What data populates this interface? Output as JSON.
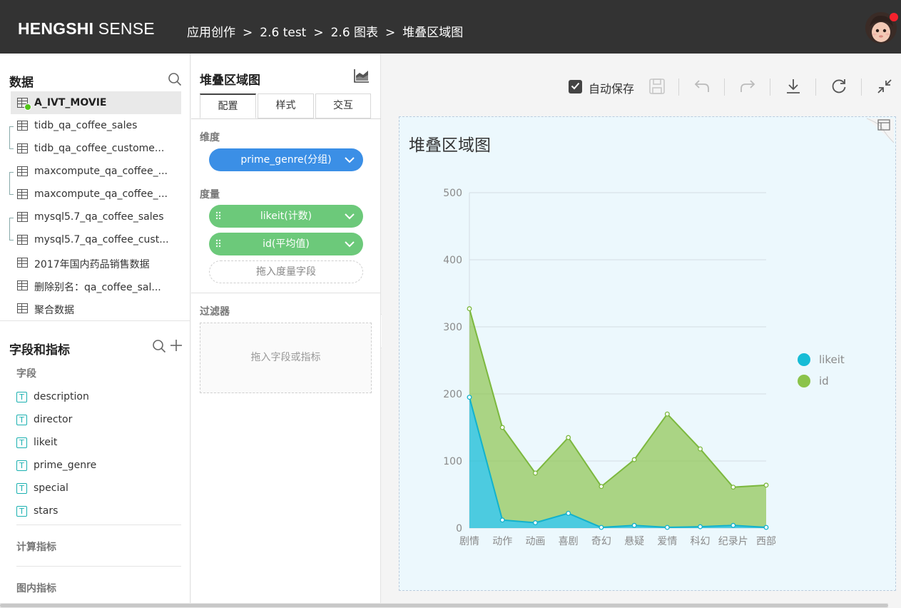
{
  "header": {
    "brand_bold": "HENGSHI",
    "brand_light": "SENSE",
    "breadcrumbs": [
      "应用创作",
      "2.6 test",
      "2.6 图表",
      "堆叠区域图"
    ],
    "separator": ">"
  },
  "data_panel": {
    "title": "数据",
    "tables": [
      "A_IVT_MOVIE",
      "tidb_qa_coffee_sales",
      "tidb_qa_coffee_custome...",
      "maxcompute_qa_coffee_...",
      "maxcompute_qa_coffee_...",
      "mysql5.7_qa_coffee_sales",
      "mysql5.7_qa_coffee_cust...",
      "2017年国内药品销售数据",
      "删除别名：qa_coffee_sal...",
      "聚合数据"
    ]
  },
  "fields_panel": {
    "title": "字段和指标",
    "fields_label": "字段",
    "fields": [
      "description",
      "director",
      "likeit",
      "prime_genre",
      "special",
      "stars"
    ],
    "type_glyph": "T",
    "calc_label": "计算指标",
    "inchart_label": "图内指标"
  },
  "config_panel": {
    "title": "堆叠区域图",
    "tabs": [
      "配置",
      "样式",
      "交互"
    ],
    "dimension_label": "维度",
    "dimension_pill": "prime_genre(分组)",
    "measure_label": "度量",
    "measure_pills": [
      "likeit(计数)",
      "id(平均值)"
    ],
    "measure_drop": "拖入度量字段",
    "filter_label": "过滤器",
    "filter_drop": "拖入字段或指标"
  },
  "toolbar": {
    "autosave_label": "自动保存",
    "autosave_checked": true
  },
  "chart_data": {
    "type": "area",
    "stacked": true,
    "title": "堆叠区域图",
    "categories": [
      "剧情",
      "动作",
      "动画",
      "喜剧",
      "奇幻",
      "悬疑",
      "爱情",
      "科幻",
      "纪录片",
      "西部"
    ],
    "series": [
      {
        "name": "likeit",
        "values": [
          195,
          12,
          8,
          22,
          1,
          4,
          1,
          2,
          4,
          1
        ],
        "color": "#17bcd6"
      },
      {
        "name": "id",
        "values": [
          132,
          138,
          74,
          113,
          61,
          98,
          169,
          116,
          57,
          63
        ],
        "color": "#8bc34a"
      }
    ],
    "ylim": [
      0,
      500
    ],
    "yticks": [
      0,
      100,
      200,
      300,
      400,
      500
    ],
    "grid": true,
    "legend": "right"
  },
  "colors": {
    "topbar": "#333333",
    "accent_blue": "#3b8fe6",
    "accent_green": "#6cc97a",
    "canvas_bg": "#ecf8fd"
  }
}
